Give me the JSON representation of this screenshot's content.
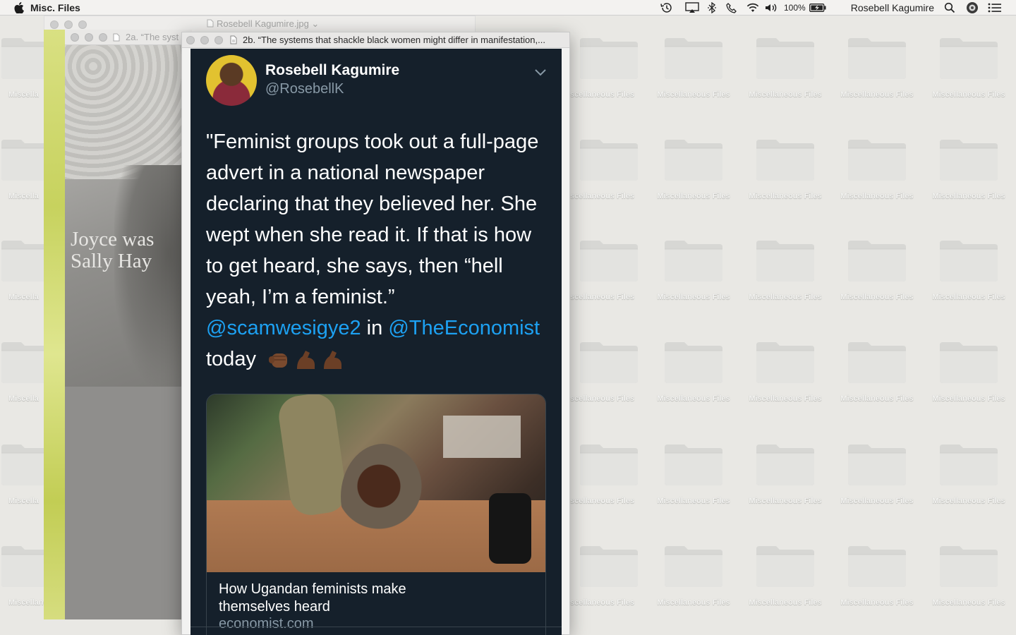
{
  "menubar": {
    "app_name": "Misc. Files",
    "battery_percent": "100%",
    "user_name": "Rosebell Kagumire"
  },
  "desktop": {
    "folder_label": "Miscellaneous Files",
    "folder_label_cut_left": "Miscella",
    "folder_label_cut_center": "scellaneous Files",
    "folder_label_bottom_left": "Miscellaneou"
  },
  "windows": {
    "back_preview_title": "Rosebell Kagumire.jpg",
    "middle_preview_title": "2a. “The syst",
    "middle_caption_line1": "Joyce was",
    "middle_caption_line2": "Sally Hay",
    "front_preview_title": "2b. “The systems that shackle black women might differ in manifestation,..."
  },
  "tweet": {
    "author_name": "Rosebell Kagumire",
    "author_handle": "@RosebellK",
    "lines": [
      "\"Feminist groups took out a full-page",
      "advert in a national newspaper",
      "declaring that they believed her. She",
      "wept when she read it. If that is how",
      "to get heard, she says, then “hell",
      "yeah, I’m a feminist.”"
    ],
    "mention_1": "@scamwesigye2",
    "connector": " in ",
    "mention_2": "@TheEconomist",
    "tail": "today",
    "emojis": [
      "raised-fist-emoji",
      "flexed-biceps-emoji",
      "flexed-biceps-emoji"
    ],
    "card": {
      "title_line1": "How Ugandan feminists make",
      "title_line2": "themselves heard",
      "domain": "economist.com"
    }
  },
  "colors": {
    "tweet_background": "#15202b",
    "mention": "#1da1f2",
    "secondary_text": "#8899a6",
    "desktop_background": "#e9e8e4"
  }
}
